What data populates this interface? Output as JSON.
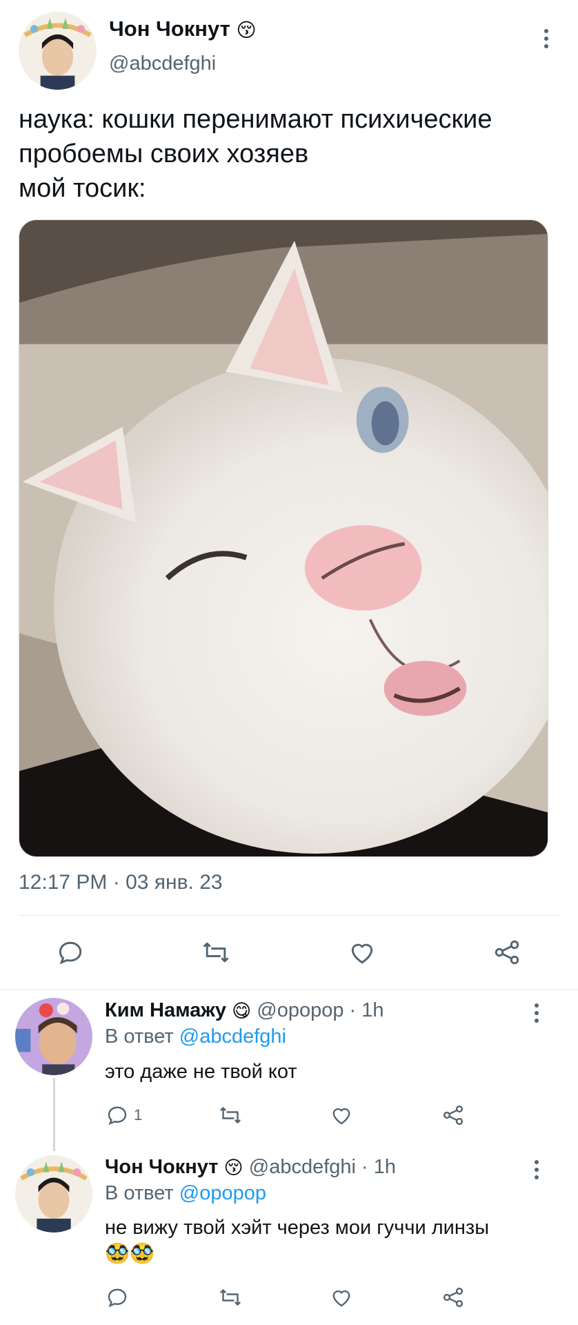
{
  "main_tweet": {
    "author_name": "Чон Чокнут",
    "author_emoji": "😚",
    "author_handle": "@abcdefghi",
    "text": "наука: кошки перенимают психические\nпробоемы своих хозяев\nмой тосик:",
    "timestamp": "12:17 PM · 03 янв. 23",
    "actions": {
      "reply_icon": "reply-icon",
      "retweet_icon": "retweet-icon",
      "like_icon": "like-icon",
      "share_icon": "share-icon"
    }
  },
  "replies": [
    {
      "author_name": "Ким Намажу",
      "author_emoji": "😋",
      "handle_time": "@opopop · 1h",
      "replying_prefix": "В ответ",
      "replying_to": "@abcdefghi",
      "text": "это даже не твой кот",
      "reply_count": "1"
    },
    {
      "author_name": "Чон Чокнут",
      "author_emoji": "😚",
      "handle_time": "@abcdefghi · 1h",
      "replying_prefix": "В ответ",
      "replying_to": "@opopop",
      "text": "не вижу твой хэйт через мои гуччи линзы",
      "text_emoji": "🥸🥸",
      "reply_count": ""
    }
  ],
  "colors": {
    "accent": "#1d9bf0",
    "muted": "#536471",
    "text": "#0f1419",
    "divider": "#e6e9eb"
  }
}
